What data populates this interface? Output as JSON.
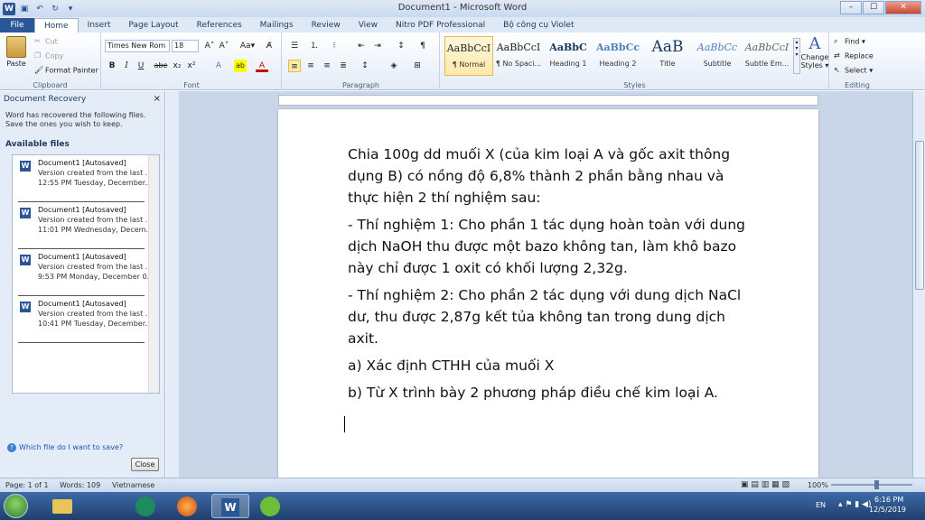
{
  "window": {
    "title": "Document1 - Microsoft Word",
    "minimize": "–",
    "maximize": "☐",
    "close": "✕"
  },
  "tabs": [
    "File",
    "Home",
    "Insert",
    "Page Layout",
    "References",
    "Mailings",
    "Review",
    "View",
    "Nitro PDF Professional",
    "Bộ công cụ Violet"
  ],
  "ribbon": {
    "clipboard": {
      "label": "Clipboard",
      "paste": "Paste",
      "cut": "Cut",
      "copy": "Copy",
      "format_painter": "Format Painter"
    },
    "font": {
      "label": "Font",
      "font_name": "Times New Rom",
      "font_size": "18",
      "grow": "A˄",
      "shrink": "A˅",
      "change_case": "Aa▾",
      "clear": "A̸",
      "bold": "B",
      "italic": "I",
      "underline": "U",
      "strike": "abe",
      "subscript": "x₂",
      "superscript": "x²",
      "effects": "A",
      "highlight": "ab",
      "color": "A"
    },
    "paragraph": {
      "label": "Paragraph",
      "bullets": "☰",
      "numbering": "⒈",
      "multilevel": "⁝",
      "decrease": "⇤",
      "increase": "⇥",
      "sort": "↕",
      "pilcrow": "¶"
    },
    "styles": {
      "label": "Styles",
      "items": [
        {
          "sample": "AaBbCcI",
          "name": "¶ Normal"
        },
        {
          "sample": "AaBbCcI",
          "name": "¶ No Spaci..."
        },
        {
          "sample": "AaBbC",
          "name": "Heading 1"
        },
        {
          "sample": "AaBbCc",
          "name": "Heading 2"
        },
        {
          "sample": "AaB",
          "name": "Title"
        },
        {
          "sample": "AaBbCc",
          "name": "Subtitle"
        },
        {
          "sample": "AaBbCcI",
          "name": "Subtle Em..."
        }
      ],
      "change_styles_1": "Change",
      "change_styles_2": "Styles ▾"
    },
    "editing": {
      "label": "Editing",
      "find": "Find ▾",
      "replace": "Replace",
      "select": "Select ▾"
    }
  },
  "recovery": {
    "title": "Document Recovery",
    "message": "Word has recovered the following files.  Save the ones you wish to keep.",
    "available": "Available files",
    "files": [
      {
        "name": "Document1  [Autosaved]",
        "desc": "Version created from the last ...",
        "time": "12:55 PM Tuesday, December..."
      },
      {
        "name": "Document1  [Autosaved]",
        "desc": "Version created from the last ...",
        "time": "11:01 PM Wednesday, Decem..."
      },
      {
        "name": "Document1  [Autosaved]",
        "desc": "Version created from the last ...",
        "time": "9:53 PM Monday, December 0..."
      },
      {
        "name": "Document1  [Autosaved]",
        "desc": "Version created from the last ...",
        "time": "10:41 PM Tuesday, December..."
      }
    ],
    "help_link": "Which file do I want to save?",
    "close_button": "Close"
  },
  "document": {
    "paragraphs": [
      "Chia 100g dd muối X (của kim loại A và gốc axit thông dụng B) có nồng độ 6,8% thành 2 phần bằng nhau và thực hiện 2 thí nghiệm sau:",
      "- Thí nghiệm 1: Cho phần 1 tác dụng hoàn toàn với dung dịch NaOH thu được một bazo không tan, làm khô bazo này chỉ được 1 oxit có khối lượng 2,32g.",
      "- Thí nghiệm 2: Cho phần 2 tác dụng với dung dịch NaCl dư, thu được 2,87g kết tủa không tan trong dung dịch axit.",
      "a) Xác định CTHH của muối X",
      "b) Từ X trình bày 2 phương pháp điều chế kim loại A."
    ]
  },
  "status": {
    "page": "Page: 1 of 1",
    "words": "Words: 109",
    "language": "Vietnamese",
    "zoom": "100%",
    "zoom_percent": 100
  },
  "taskbar": {
    "lang": "EN",
    "time": "6:16 PM",
    "date": "12/5/2019"
  }
}
